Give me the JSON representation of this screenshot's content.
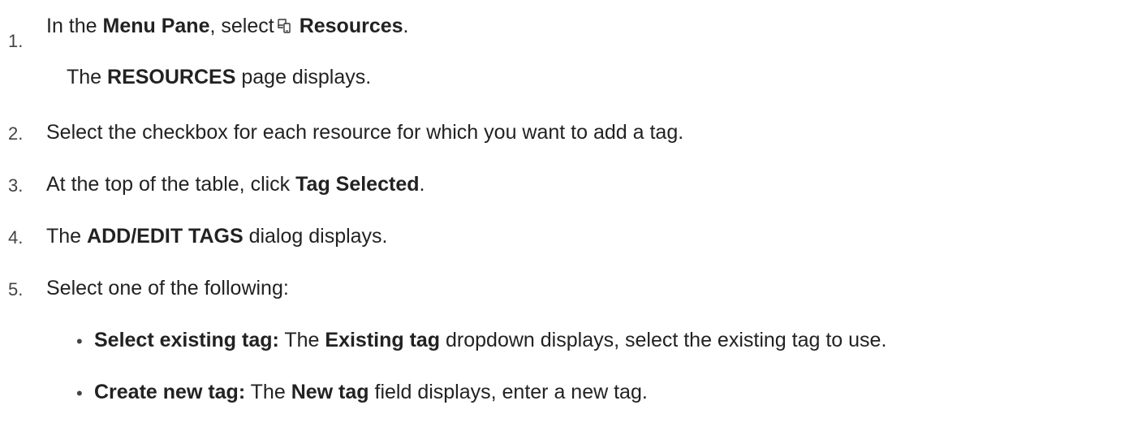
{
  "steps": [
    {
      "number": "1.",
      "pre": "In the ",
      "pane": "Menu Pane",
      "mid": ", select",
      "icon": "resources-icon",
      "target": "Resources",
      "post": ".",
      "sub_pre": "The ",
      "sub_bold": "RESOURCES",
      "sub_post": " page displays."
    },
    {
      "number": "2.",
      "text": "Select the checkbox for each resource for which you want to add a tag."
    },
    {
      "number": "3.",
      "pre": "At the top of the table, click ",
      "bold": "Tag Selected",
      "post": "."
    },
    {
      "number": "4.",
      "pre": "The ",
      "bold": "ADD/EDIT TAGS",
      "post": " dialog displays."
    },
    {
      "number": "5.",
      "text": "Select one of the following:"
    }
  ],
  "options": [
    {
      "bullet": "•",
      "label": "Select existing tag:",
      "pre": " The ",
      "bold": "Existing tag",
      "post": " dropdown displays, select the existing tag to use."
    },
    {
      "bullet": "•",
      "label": "Create new tag:",
      "pre": " The ",
      "bold": "New tag",
      "post": " field displays, enter a new tag."
    }
  ]
}
